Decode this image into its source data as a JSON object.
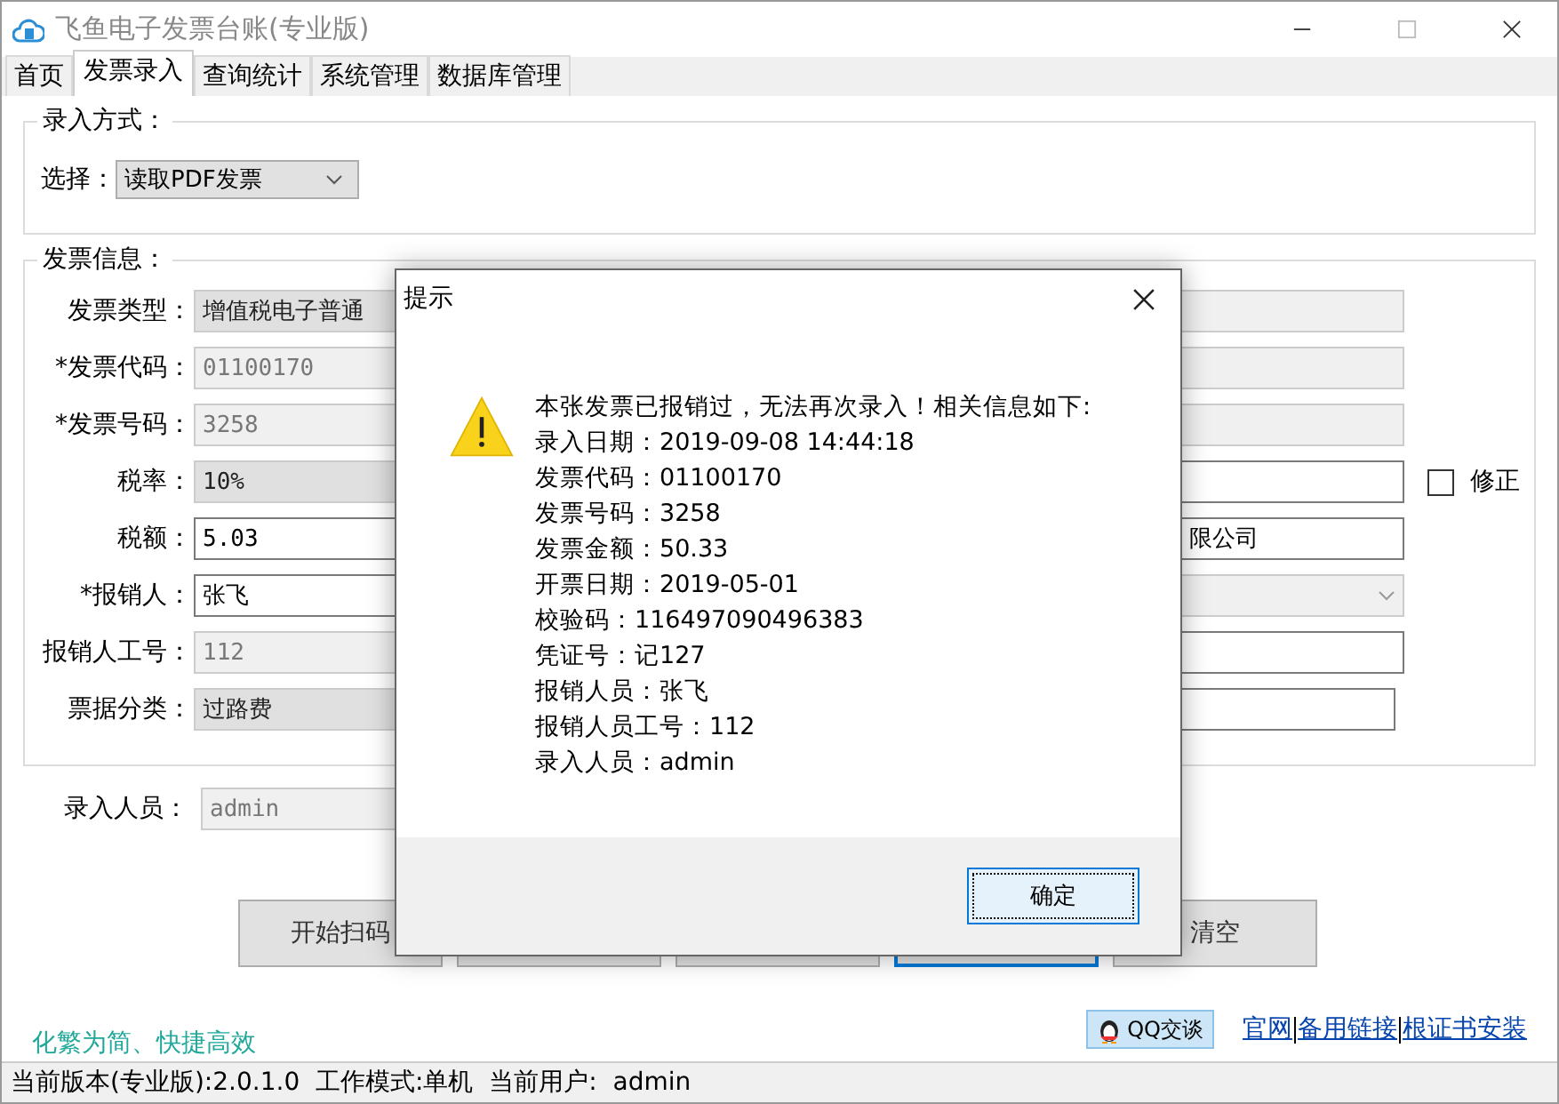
{
  "window": {
    "title": "飞鱼电子发票台账(专业版)"
  },
  "tabs": [
    {
      "label": "首页",
      "selected": false
    },
    {
      "label": "发票录入",
      "selected": true
    },
    {
      "label": "查询统计",
      "selected": false
    },
    {
      "label": "系统管理",
      "selected": false
    },
    {
      "label": "数据库管理",
      "selected": false
    }
  ],
  "input_method": {
    "legend": "录入方式：",
    "label": "选择：",
    "value": "读取PDF发票"
  },
  "invoice_info": {
    "legend": "发票信息：",
    "rows": [
      {
        "label": "发票类型：",
        "left": {
          "kind": "combo",
          "value": "增值税电子普通",
          "disabled": true
        },
        "right": {
          "kind": "text",
          "disabled": true
        }
      },
      {
        "label": "*发票代码：",
        "left": {
          "kind": "text",
          "value": "01100170",
          "disabled": true
        },
        "right": {
          "kind": "text",
          "disabled": true
        }
      },
      {
        "label": "*发票号码：",
        "left": {
          "kind": "text",
          "value": "3258",
          "disabled": true
        },
        "right": {
          "kind": "text",
          "disabled": true
        }
      },
      {
        "label": "税率：",
        "left": {
          "kind": "combo",
          "value": "10%",
          "disabled": true
        },
        "right": {
          "kind": "text",
          "disabled": false
        },
        "checkbox": {
          "label": "修正",
          "checked": false
        }
      },
      {
        "label": "税额：",
        "left": {
          "kind": "text",
          "value": "5.03",
          "disabled": false
        },
        "right": {
          "kind": "text",
          "value": "限公司",
          "disabled": false
        }
      },
      {
        "label": "*报销人：",
        "left": {
          "kind": "text",
          "value": "张飞",
          "disabled": false
        },
        "right": {
          "kind": "combo",
          "disabled": true
        }
      },
      {
        "label": "报销人工号：",
        "left": {
          "kind": "text",
          "value": "112",
          "disabled": true
        },
        "right": {
          "kind": "text",
          "disabled": false
        }
      },
      {
        "label": "票据分类：",
        "left": {
          "kind": "combo",
          "value": "过路费",
          "disabled": true
        },
        "right": {
          "kind": "text",
          "disabled": false
        }
      }
    ]
  },
  "entry_person": {
    "label": "录入人员：",
    "value": "admin"
  },
  "buttons": [
    {
      "kind": "text",
      "label": "开始扫码",
      "focused": false
    },
    {
      "kind": "covered",
      "focused": false
    },
    {
      "kind": "covered",
      "focused": false
    },
    {
      "kind": "covered",
      "focused": true
    },
    {
      "kind": "text",
      "label": "清空",
      "focused": false
    }
  ],
  "slogan": "化繁为简、快捷高效",
  "qq_button": "QQ交谈",
  "links": [
    "官网",
    "备用链接",
    "根证书安装"
  ],
  "status_bar": "当前版本(专业版):2.0.1.0  工作模式:单机  当前用户:  admin",
  "dialog": {
    "title": "提示",
    "lines": [
      "本张发票已报销过，无法再次录入！相关信息如下:",
      "录入日期：2019-09-08 14:44:18",
      "发票代码：01100170",
      "发票号码：3258",
      "发票金额：50.33",
      "开票日期：2019-05-01",
      "校验码：116497090496383",
      "凭证号：记127",
      "报销人员：张飞",
      "报销人员工号：112",
      "录入人员：admin"
    ],
    "ok": "确定"
  }
}
